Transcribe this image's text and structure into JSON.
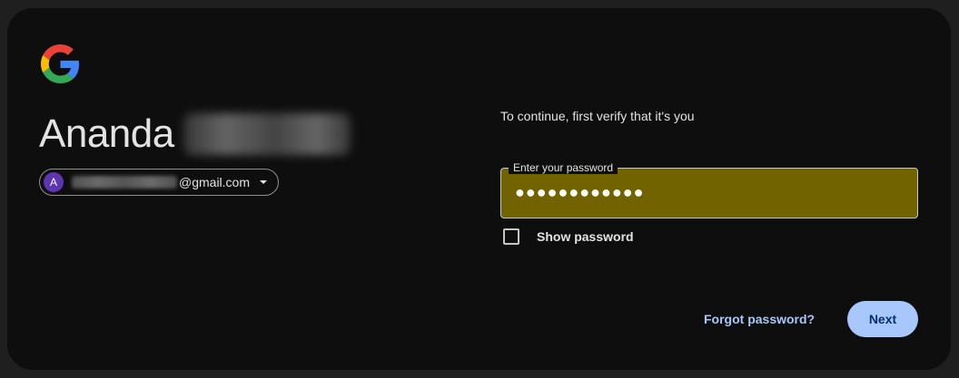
{
  "brand": {
    "icon": "google-g-icon",
    "colors": {
      "blue": "#4285F4",
      "red": "#EA4335",
      "yellow": "#FBBC05",
      "green": "#34A853"
    }
  },
  "account": {
    "first_name": "Ananda",
    "last_name_blurred": true,
    "avatar_letter": "A",
    "avatar_color": "#5e35b1",
    "email_local_blurred": true,
    "email_domain": "@gmail.com"
  },
  "form": {
    "subtitle": "To continue, first verify that it's you",
    "password_label": "Enter your password",
    "password_value": "●●●●●●●●●●●●",
    "field_fill_color": "#716400",
    "show_password_label": "Show password",
    "show_password_checked": false
  },
  "actions": {
    "forgot_label": "Forgot password?",
    "next_label": "Next",
    "accent": "#a8c7fa"
  }
}
